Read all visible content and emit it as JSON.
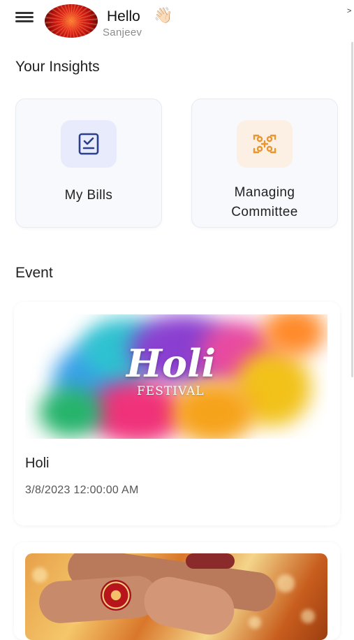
{
  "header": {
    "greeting": "Hello",
    "wave_emoji": "👋🏻",
    "username": "Sanjeev",
    "chevron": ">"
  },
  "insights": {
    "title": "Your Insights",
    "cards": [
      {
        "label": "My Bills",
        "icon": "bill-icon",
        "icon_color": "#2b3f8c",
        "bg": "#e8ebfb"
      },
      {
        "label_line1": "Managing",
        "label_line2": "Committee",
        "icon": "committee-icon",
        "icon_color": "#e8962e",
        "bg": "#fcefe3"
      }
    ]
  },
  "events": {
    "title": "Event",
    "items": [
      {
        "banner_title": "Holi",
        "banner_subtitle": "FESTIVAL",
        "name": "Holi",
        "date": "3/8/2023 12:00:00 AM"
      }
    ]
  },
  "colors": {
    "accent_blue": "#2b3f8c",
    "accent_orange": "#e8962e",
    "card_bg": "#f7f9fc"
  }
}
